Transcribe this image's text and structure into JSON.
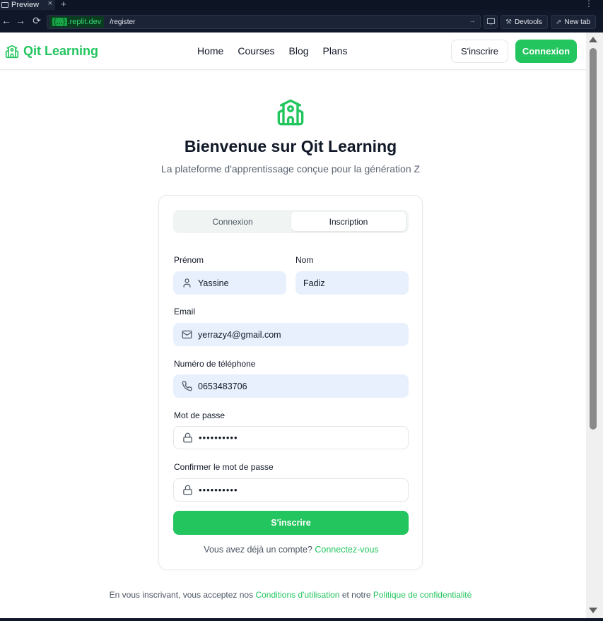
{
  "browser": {
    "tab_title": "Preview",
    "tab_close": "×",
    "new_tab_glyph": "+",
    "menu_glyph": "⋮",
    "back_glyph": "←",
    "forward_glyph": "→",
    "reload_glyph": "⟳",
    "url_host_brace": "{...}",
    "url_host": ".replit.dev",
    "url_path": "/register",
    "url_go_glyph": "→",
    "devtools_label": "Devtools",
    "new_tab_label": "New tab"
  },
  "header": {
    "logo_text": "Qit Learning",
    "nav": [
      "Home",
      "Courses",
      "Blog",
      "Plans"
    ],
    "signup_label": "S'inscrire",
    "login_label": "Connexion",
    "accent": "#22c55e"
  },
  "hero": {
    "title": "Bienvenue sur Qit Learning",
    "subtitle": "La plateforme d'apprentissage conçue pour la génération Z"
  },
  "form": {
    "tabs": [
      "Connexion",
      "Inscription"
    ],
    "active_tab": "Inscription",
    "first_name_label": "Prénom",
    "first_name_value": "Yassine",
    "last_name_label": "Nom",
    "last_name_value": "Fadiz",
    "email_label": "Email",
    "email_value": "yerrazy4@gmail.com",
    "phone_label": "Numéro de téléphone",
    "phone_value": "0653483706",
    "password_label": "Mot de passe",
    "password_value": "••••••••••",
    "confirm_label": "Confirmer le mot de passe",
    "confirm_value": "••••••••••",
    "submit_label": "S'inscrire",
    "have_account_text": "Vous avez déjà un compte?",
    "have_account_link": "Connectez-vous"
  },
  "legal": {
    "prefix": "En vous inscrivant, vous acceptez nos",
    "terms_link": "Conditions d'utilisation",
    "middle": "et notre",
    "privacy_link": "Politique de confidentialité"
  }
}
